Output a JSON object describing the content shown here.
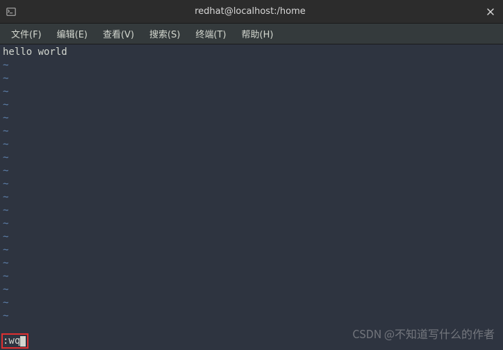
{
  "titlebar": {
    "title": "redhat@localhost:/home"
  },
  "menubar": {
    "items": [
      "文件(F)",
      "编辑(E)",
      "查看(V)",
      "搜索(S)",
      "终端(T)",
      "帮助(H)"
    ]
  },
  "terminal": {
    "content_line": "hello world",
    "tilde": "~",
    "command": ":wq"
  },
  "watermark": "CSDN @不知道写什么的作者"
}
